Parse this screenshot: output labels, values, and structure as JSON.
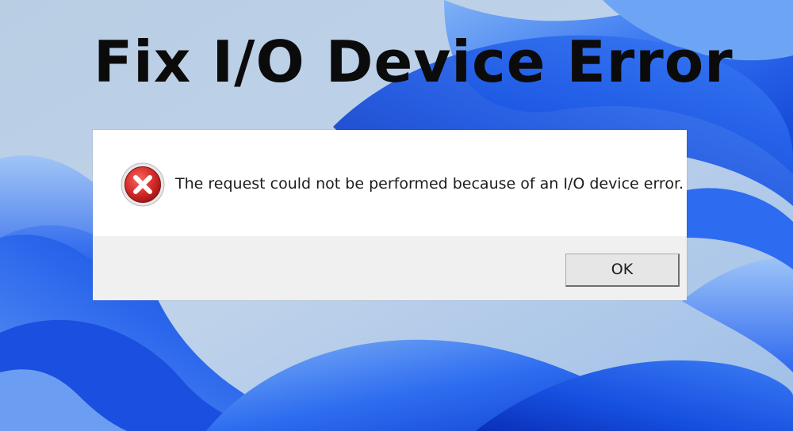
{
  "headline": "Fix I/O Device Error",
  "dialog": {
    "icon": "error-icon",
    "message": "The request could not be performed because of an I/O device error.",
    "ok_label": "OK"
  },
  "colors": {
    "error_red": "#d42a2a",
    "wallpaper_blue": "#1f5fe8",
    "button_bar": "#f0f0f0"
  }
}
